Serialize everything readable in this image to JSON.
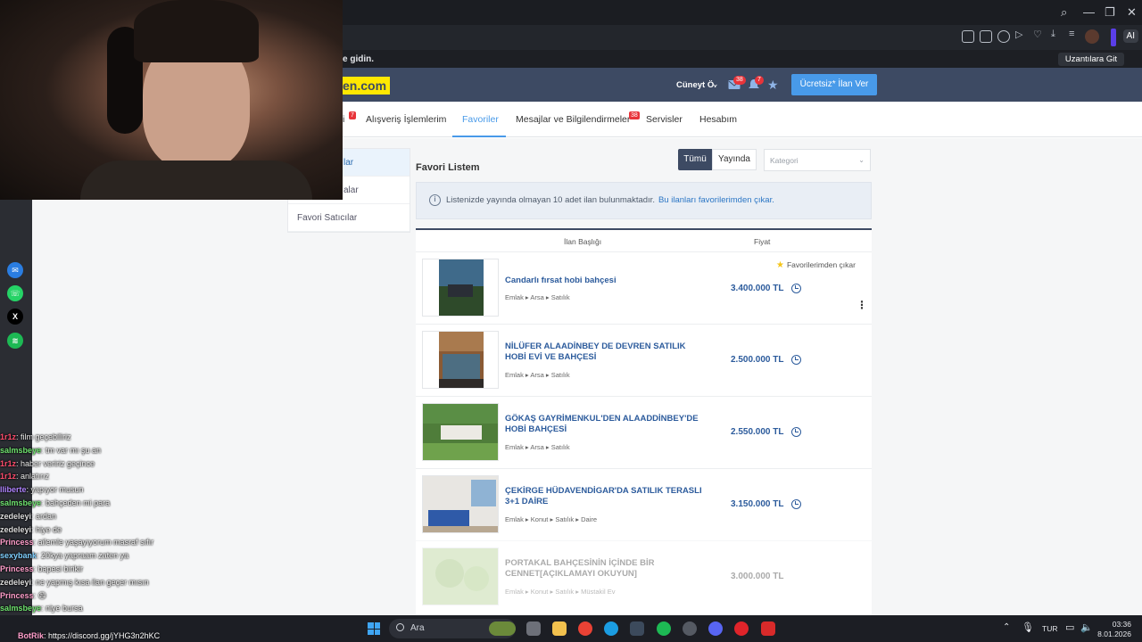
{
  "browser": {
    "info_text": "e gidin.",
    "extensions_button": "Uzantılara Git",
    "ai_label": "AI"
  },
  "header": {
    "logo_text": "en.com",
    "user_name": "Cüneyt Ö.",
    "messages_badge": "38",
    "notifications_badge": "7",
    "cta_label": "Ücretsiz* İlan Ver"
  },
  "nav": {
    "items": [
      {
        "label": "i",
        "badge": "7"
      },
      {
        "label": "Alışveriş İşlemlerim"
      },
      {
        "label": "Favoriler"
      },
      {
        "label": "Mesajlar ve Bilgilendirmeler",
        "badge": "38"
      },
      {
        "label": "Servisler"
      },
      {
        "label": "Hesabım"
      }
    ]
  },
  "sidebar": {
    "items": [
      {
        "label": "lar"
      },
      {
        "label": "alar"
      },
      {
        "label": "Favori Satıcılar"
      }
    ]
  },
  "main": {
    "title": "Favori Listem",
    "filter_all": "Tümü",
    "filter_live": "Yayında",
    "category_placeholder": "Kategori",
    "notice_text": "Listenizde yayında olmayan 10 adet ilan bulunmaktadır.",
    "notice_link": "Bu ilanları favorilerimden çıkar.",
    "col_title": "İlan Başlığı",
    "col_price": "Fiyat",
    "remove_favorite": "Favorilerimden çıkar",
    "listings": [
      {
        "title": "Candarlı fırsat hobi bahçesi",
        "crumbs": [
          "Emlak",
          "Arsa",
          "Satılık"
        ],
        "price": "3.400.000 TL"
      },
      {
        "title": "NİLÜFER ALAADİNBEY DE DEVREN SATILIK HOBİ EVİ VE BAHÇESİ",
        "crumbs": [
          "Emlak",
          "Arsa",
          "Satılık"
        ],
        "price": "2.500.000 TL"
      },
      {
        "title": "GÖKAŞ GAYRİMENKUL'DEN ALAADDİNBEY'DE HOBİ BAHÇESİ",
        "crumbs": [
          "Emlak",
          "Arsa",
          "Satılık"
        ],
        "price": "2.550.000 TL"
      },
      {
        "title": "ÇEKİRGE HÜDAVENDİGAR'DA SATILIK TERASLI 3+1 DAİRE",
        "crumbs": [
          "Emlak",
          "Konut",
          "Satılık",
          "Daire"
        ],
        "price": "3.150.000 TL"
      },
      {
        "title": "PORTAKAL BAHÇESİNİN İÇİNDE BİR CENNET[AÇIKLAMAYI OKUYUN]",
        "crumbs": [
          "Emlak",
          "Konut",
          "Satılık",
          "Müstakil Ev"
        ],
        "price": "3.000.000 TL"
      }
    ]
  },
  "chat": {
    "lines": [
      {
        "user": "1r1z",
        "msg": ": film geçebiliriz",
        "color": "#ff4d6d"
      },
      {
        "user": "salmsbeye",
        "msg": ": tm var mı şu an",
        "color": "#6fe36f"
      },
      {
        "user": "1r1z",
        "msg": ": haber veririz geçince",
        "color": "#ff4d6d"
      },
      {
        "user": "1r1z",
        "msg": ": anlatırız",
        "color": "#ff4d6d"
      },
      {
        "user": "lliberte",
        "msg": ": yapıyor musun",
        "color": "#b084ff"
      },
      {
        "user": "salmsbeye",
        "msg": ": bahçeden mi para",
        "color": "#6fe36f"
      },
      {
        "user": "zedeleyi",
        "msg": ": ardan",
        "color": "#dddddd"
      },
      {
        "user": "zedeleyi",
        "msg": ": hiye de",
        "color": "#dddddd"
      },
      {
        "user": "Princess",
        "msg": ": ailemle yaşayıyorum masraf sıfır",
        "color": "#ff9ecb"
      },
      {
        "user": "sexybank",
        "msg": ": 20kya yapraam zaten ya",
        "color": "#7fd0ff"
      },
      {
        "user": "Princess",
        "msg": ": bapesi birikir",
        "color": "#ff9ecb"
      },
      {
        "user": "zedeleyi",
        "msg": ": ne yapmış kısa ilan geçer mısın",
        "color": "#dddddd"
      },
      {
        "user": "Princess",
        "msg": ": 😄",
        "color": "#ff9ecb"
      },
      {
        "user": "salmsbeye",
        "msg": ": niye bursa",
        "color": "#6fe36f"
      }
    ],
    "link_user": "BotRik",
    "link_text": "https://discord.gg/jYHG3n2hKC"
  },
  "taskbar": {
    "search_placeholder": "Ara",
    "language": "TUR",
    "time": "03:36",
    "date": "8.01.2026"
  },
  "colors": {
    "header_bg": "#3d4a63",
    "accent": "#489ae9",
    "logo_yellow": "#ffe800",
    "link_blue": "#2c5b9c"
  }
}
